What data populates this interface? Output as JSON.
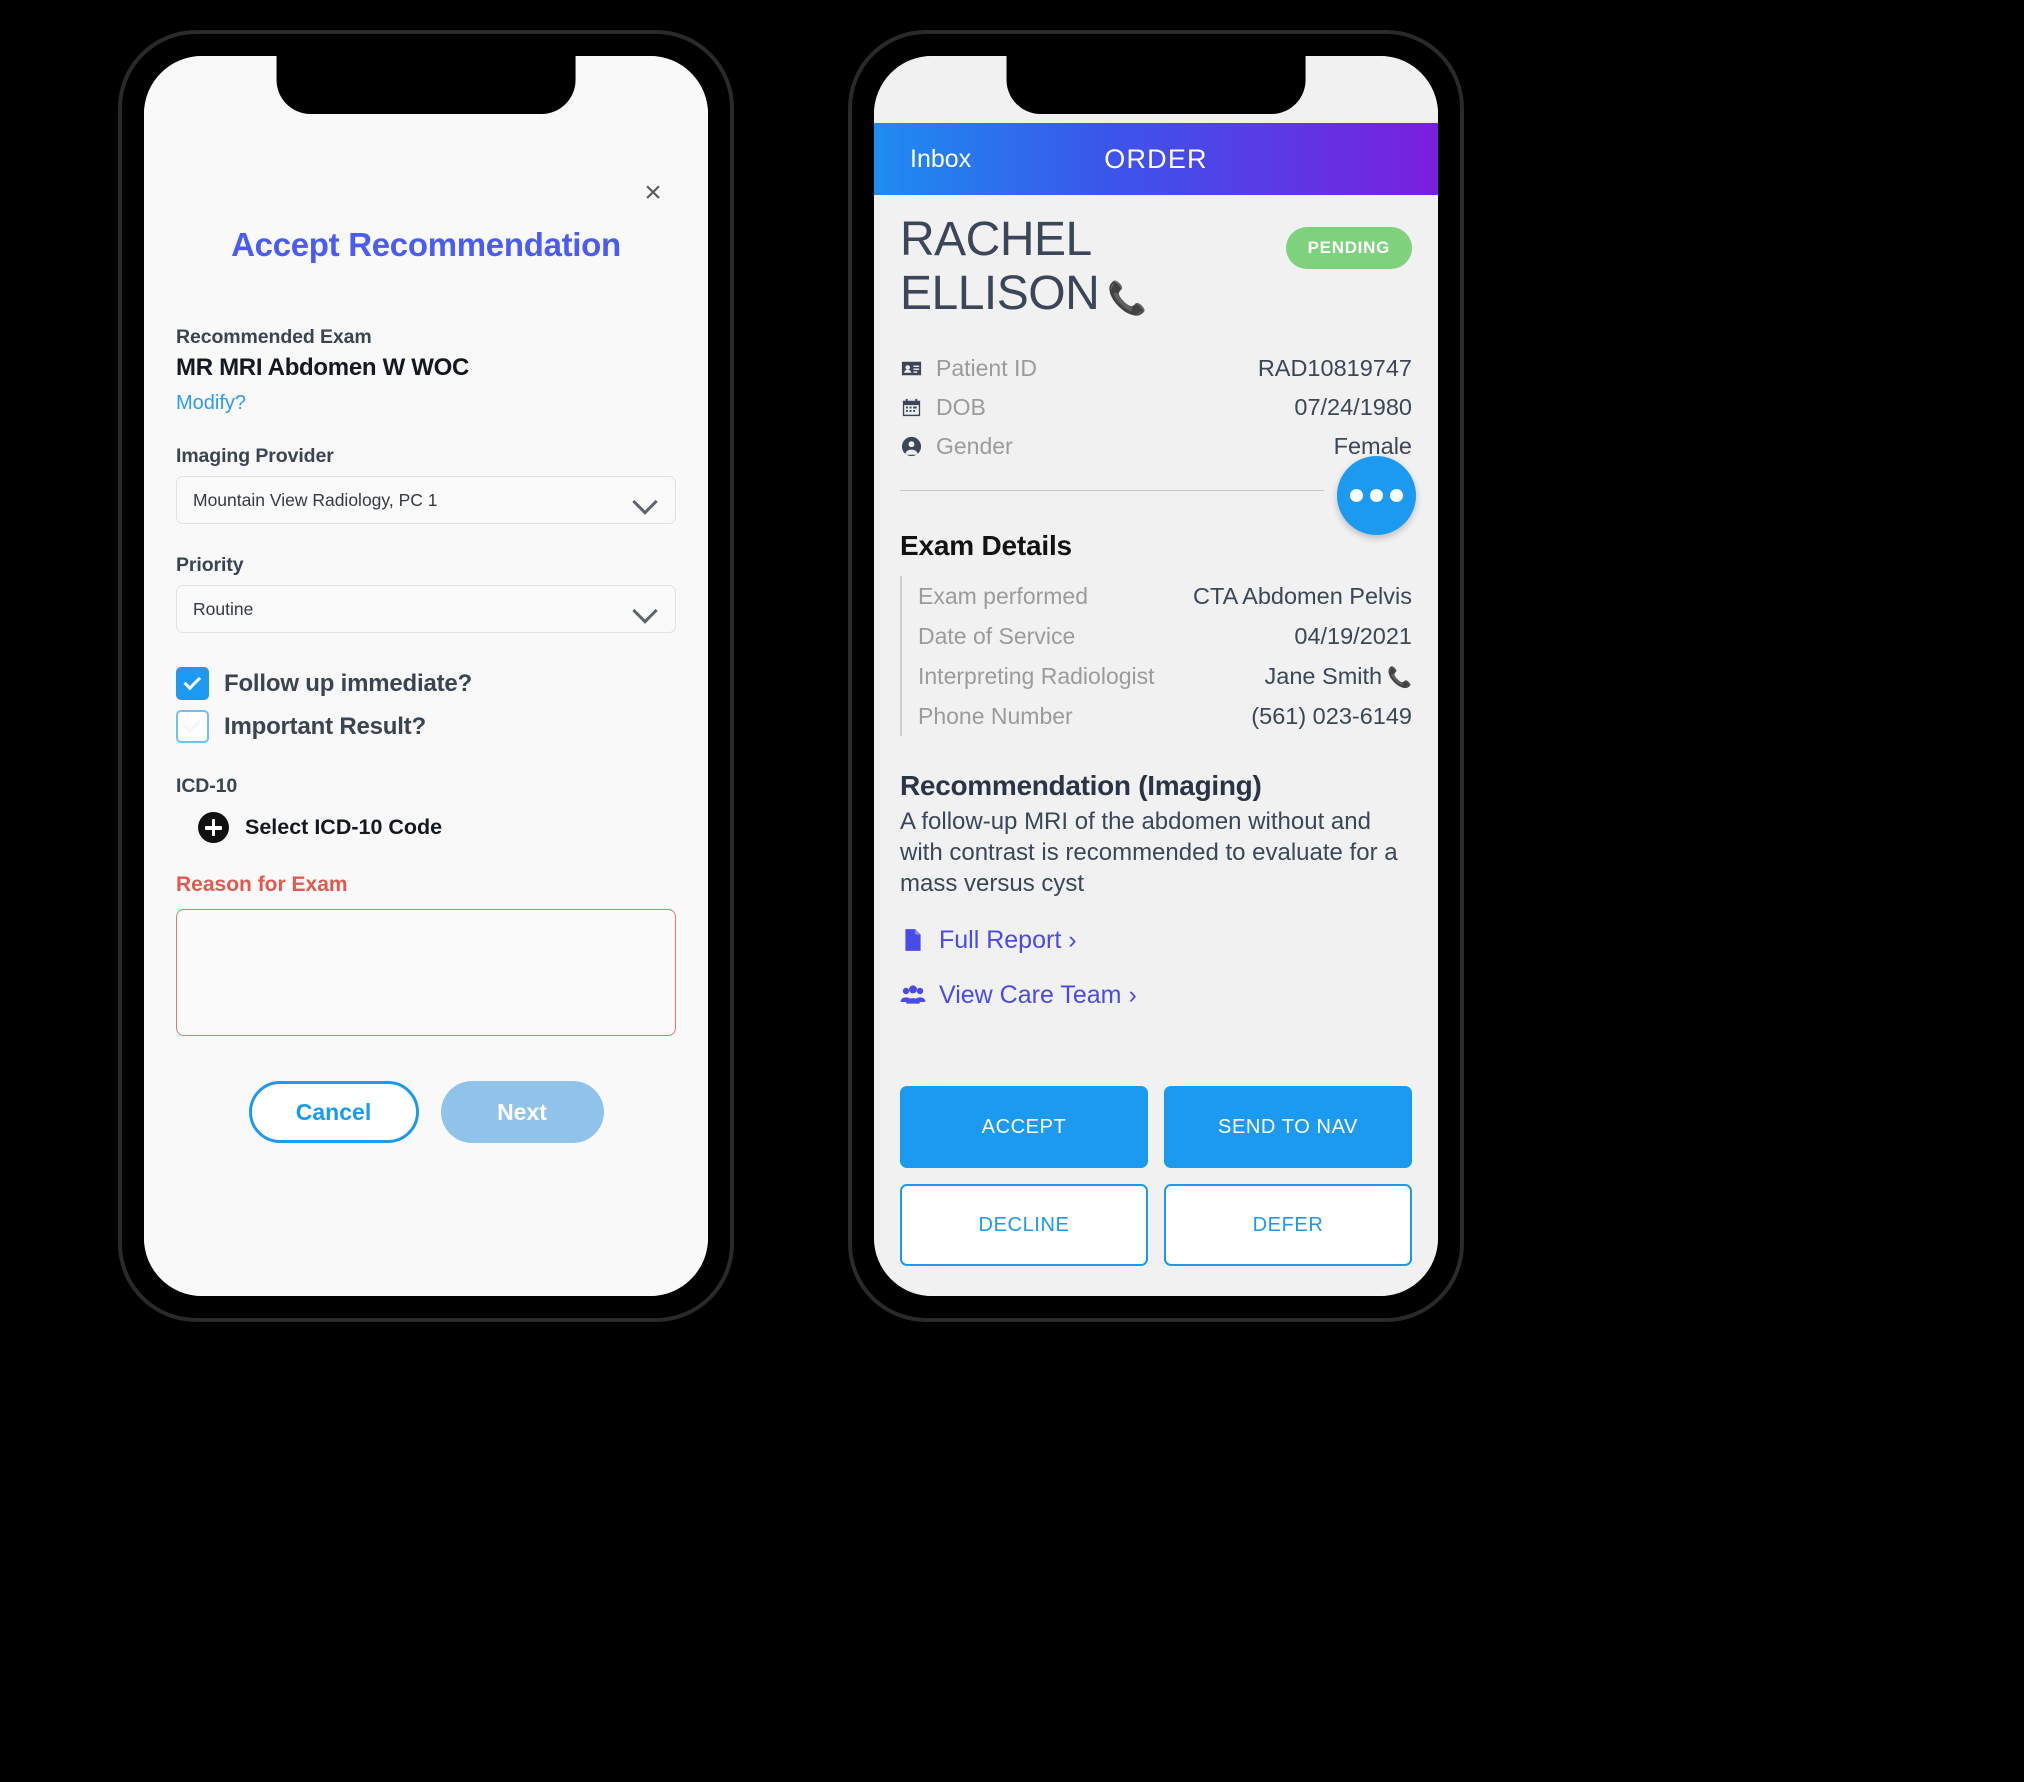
{
  "left_phone": {
    "close_icon_label": "×",
    "title": "Accept Recommendation",
    "recommended_exam": {
      "label": "Recommended Exam",
      "value": "MR MRI Abdomen W WOC",
      "modify_link": "Modify?"
    },
    "imaging_provider": {
      "label": "Imaging Provider",
      "value": "Mountain View Radiology, PC 1"
    },
    "priority": {
      "label": "Priority",
      "value": "Routine"
    },
    "checkboxes": [
      {
        "label": "Follow up immediate?",
        "checked": true
      },
      {
        "label": "Important Result?",
        "checked": false
      }
    ],
    "icd10": {
      "label": "ICD-10",
      "action": "Select ICD-10 Code"
    },
    "reason_for_exam": {
      "label": "Reason for Exam",
      "value": "",
      "placeholder": ""
    },
    "buttons": {
      "cancel": "Cancel",
      "next": "Next"
    }
  },
  "right_phone": {
    "nav": {
      "back_label": "Inbox",
      "title": "ORDER"
    },
    "patient": {
      "first_name": "RACHEL",
      "last_name": "ELLISON",
      "status_badge": "PENDING",
      "fields": [
        {
          "icon": "id-card-icon",
          "key": "Patient ID",
          "value": "RAD10819747"
        },
        {
          "icon": "calendar-icon",
          "key": "DOB",
          "value": "07/24/1980"
        },
        {
          "icon": "person-icon",
          "key": "Gender",
          "value": "Female"
        }
      ]
    },
    "exam_details": {
      "title": "Exam Details",
      "rows": [
        {
          "key": "Exam performed",
          "value": "CTA Abdomen Pelvis",
          "phone": false
        },
        {
          "key": "Date of Service",
          "value": "04/19/2021",
          "phone": false
        },
        {
          "key": "Interpreting Radiologist",
          "value": "Jane Smith",
          "phone": true
        },
        {
          "key": "Phone Number",
          "value": "(561) 023-6149",
          "phone": false
        }
      ]
    },
    "recommendation": {
      "title": "Recommendation (Imaging)",
      "text": "A follow-up MRI of the abdomen without and with contrast is recommended to evaluate for a mass versus cyst"
    },
    "links": [
      {
        "icon": "document-icon",
        "label": "Full Report ›"
      },
      {
        "icon": "care-team-icon",
        "label": "View Care Team ›"
      }
    ],
    "actions": [
      {
        "label": "ACCEPT",
        "style": "filled"
      },
      {
        "label": "SEND TO NAV",
        "style": "filled"
      },
      {
        "label": "DECLINE",
        "style": "outline"
      },
      {
        "label": "DEFER",
        "style": "outline"
      }
    ]
  },
  "colors": {
    "accent_blue": "#1c9af0",
    "title_purple": "#4a5cf5",
    "link_indigo": "#4a4ae8",
    "badge_green": "#7ed27e",
    "error_red": "#e05a50",
    "nav_gradient_start": "#1d8df0",
    "nav_gradient_end": "#7a1fdd"
  }
}
